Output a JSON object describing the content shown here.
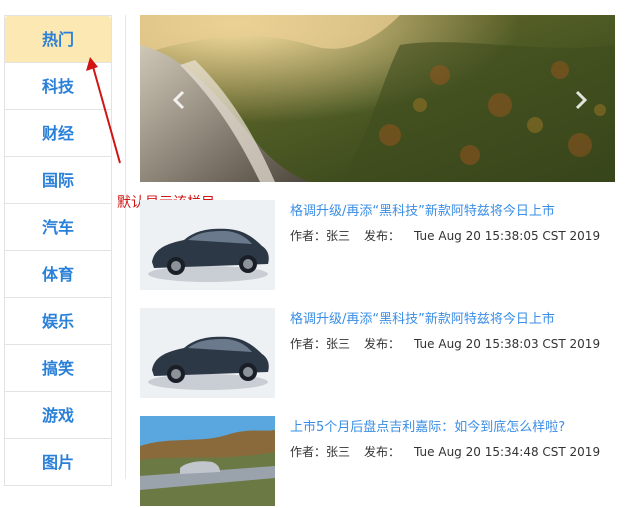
{
  "sidebar": {
    "items": [
      {
        "label": "热门"
      },
      {
        "label": "科技"
      },
      {
        "label": "财经"
      },
      {
        "label": "国际"
      },
      {
        "label": "汽车"
      },
      {
        "label": "体育"
      },
      {
        "label": "娱乐"
      },
      {
        "label": "搞笑"
      },
      {
        "label": "游戏"
      },
      {
        "label": "图片"
      }
    ]
  },
  "annotation": "默认显示该栏目",
  "news": [
    {
      "title": "格调升级/再添“黑科技”新款阿特兹将今日上市",
      "author_label": "作者：",
      "author": "张三",
      "publish_label": "发布：",
      "date": "Tue Aug 20 15:38:05 CST 2019"
    },
    {
      "title": "格调升级/再添“黑科技”新款阿特兹将今日上市",
      "author_label": "作者：",
      "author": "张三",
      "publish_label": "发布：",
      "date": "Tue Aug 20 15:38:03 CST 2019"
    },
    {
      "title": "上市5个月后盘点吉利嘉际：如今到底怎么样啦?",
      "author_label": "作者：",
      "author": "张三",
      "publish_label": "发布：",
      "date": "Tue Aug 20 15:34:48 CST 2019"
    }
  ],
  "colors": {
    "accent": "#2a80d8",
    "active_bg": "#fbe8b3",
    "annotation": "#d01515"
  }
}
